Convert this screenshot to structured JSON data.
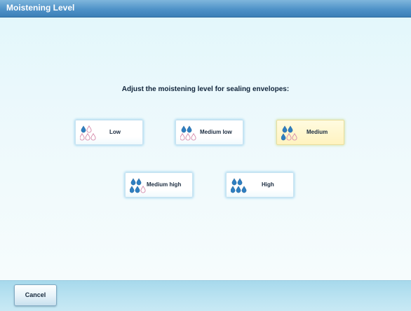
{
  "window": {
    "title": "Moistening Level"
  },
  "main": {
    "instruction": "Adjust the moistening level for sealing envelopes:",
    "levels": [
      {
        "label": "Low",
        "filled_drops": 1,
        "selected": false
      },
      {
        "label": "Medium low",
        "filled_drops": 2,
        "selected": false
      },
      {
        "label": "Medium",
        "filled_drops": 3,
        "selected": true
      },
      {
        "label": "Medium high",
        "filled_drops": 4,
        "selected": false
      },
      {
        "label": "High",
        "filled_drops": 5,
        "selected": false
      }
    ],
    "drop_icon": "water-drops-icon",
    "colors": {
      "drop_filled": "#2f7fc1",
      "drop_empty_outline": "#d48aaa",
      "selected_background": "#fff3c0"
    }
  },
  "footer": {
    "cancel_label": "Cancel"
  }
}
